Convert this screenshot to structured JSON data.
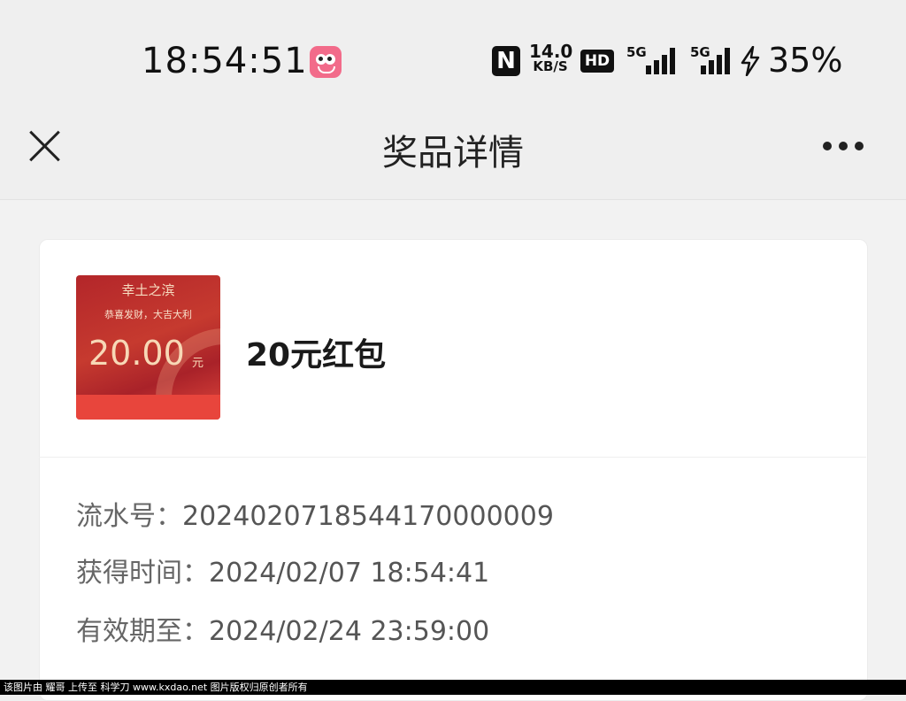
{
  "status_bar": {
    "time": "18:54:51",
    "nfc_label": "N",
    "net_speed_value": "14.0",
    "net_speed_unit": "KB/S",
    "hd_label": "HD",
    "sim1_label": "5G",
    "sim2_label": "5G",
    "battery": "35%"
  },
  "nav": {
    "title": "奖品详情"
  },
  "prize": {
    "thumbnail": {
      "brand": "幸土之滨",
      "blessing": "恭喜发财，大吉大利",
      "amount": "20.00",
      "unit": "元"
    },
    "name": "20元红包"
  },
  "details": [
    {
      "label": "流水号：",
      "value": "2024020718544170000009"
    },
    {
      "label": "获得时间：",
      "value": "2024/02/07 18:54:41"
    },
    {
      "label": "有效期至：",
      "value": "2024/02/24 23:59:00"
    }
  ],
  "watermark": "该图片由 耀哥 上传至 科学刀 www.kxdao.net 图片版权归原创者所有",
  "colors": {
    "background": "#efefef",
    "card": "#ffffff",
    "redpacket": "#c63a2f"
  }
}
